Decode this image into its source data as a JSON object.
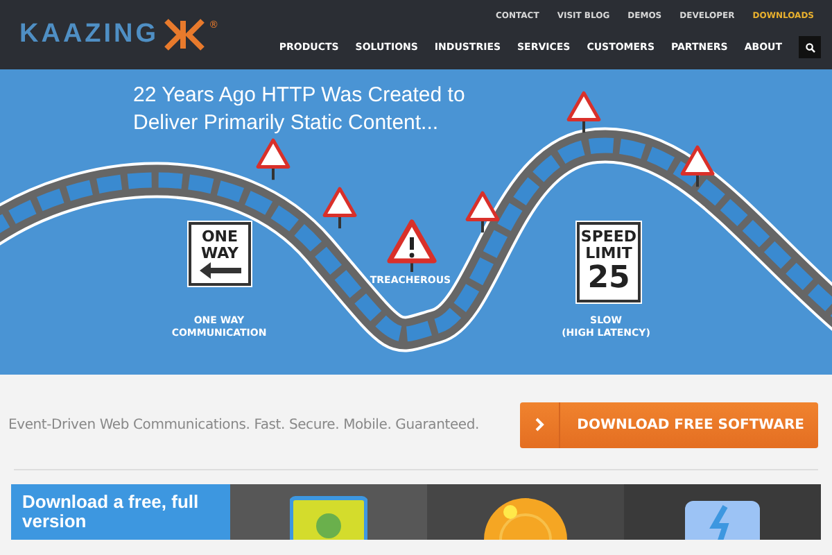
{
  "header": {
    "logo": "KAAZING",
    "logo_mark": "®",
    "top_links": [
      {
        "label": "CONTACT",
        "selected": false
      },
      {
        "label": "VISIT BLOG",
        "selected": false
      },
      {
        "label": "DEMOS",
        "selected": false
      },
      {
        "label": "DEVELOPER",
        "selected": false
      },
      {
        "label": "DOWNLOADS",
        "selected": true
      }
    ],
    "main_nav": [
      "PRODUCTS",
      "SOLUTIONS",
      "INDUSTRIES",
      "SERVICES",
      "CUSTOMERS",
      "PARTNERS",
      "ABOUT"
    ]
  },
  "hero": {
    "heading": "22 Years Ago HTTP Was Created to Deliver Primarily Static Content...",
    "one_way_sign": [
      "ONE",
      "WAY"
    ],
    "one_way_caption": [
      "ONE WAY",
      "COMMUNICATION"
    ],
    "treacherous_caption": "TREACHEROUS",
    "speed_sign": [
      "SPEED",
      "LIMIT",
      "25"
    ],
    "speed_caption": [
      "SLOW",
      "(HIGH LATENCY)"
    ]
  },
  "cta": {
    "tagline": "Event-Driven Web Communications. Fast. Secure. Mobile. Guaranteed.",
    "button": "DOWNLOAD FREE SOFTWARE"
  },
  "promo": {
    "title": "Download a free, full version"
  }
}
